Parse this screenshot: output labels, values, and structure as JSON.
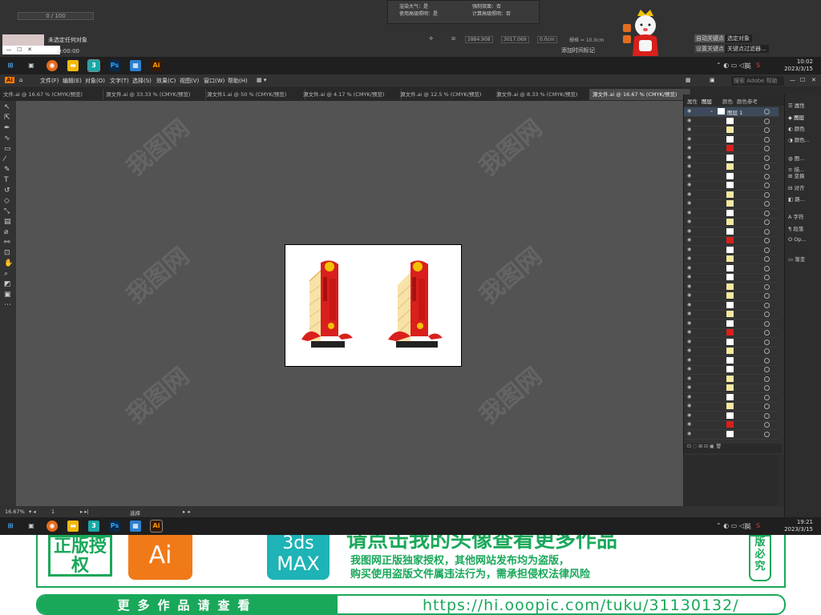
{
  "top_region": {
    "progress_text": "0 / 100",
    "no_selection": "未选定任何对象",
    "timecode": "0:00:00",
    "doc_info": {
      "row1_a": "渲染大气：是",
      "row1_b": "强制双面：否",
      "row2_a": "使用高级照明：是",
      "row2_b": "计算高级照明：否"
    },
    "coord_x": "2884.908",
    "coord_y": "3017.069",
    "coord_z": "0.0cm",
    "grid_label": "栅格 = 10.0cm",
    "add_time_marker": "添加时间标记",
    "auto_key": "自动关键点",
    "select_object": "选定对象",
    "set_key": "设置关键点",
    "key_filter": "关键点过滤器..."
  },
  "taskbar_top": {
    "time": "10:02",
    "date": "2023/3/15",
    "lang": "英"
  },
  "ai_menu": [
    "文件(F)",
    "编辑(E)",
    "对象(O)",
    "文字(T)",
    "选择(S)",
    "效果(C)",
    "视图(V)",
    "窗口(W)",
    "帮助(H)"
  ],
  "search_placeholder": "搜索 Adobe 帮助",
  "doc_tabs": [
    "文件.ai @ 16.67 % (CMYK/预览)",
    "源文件.ai @ 33.33 % (CMYK/预览)",
    "源文件1.ai @ 50 % (CMYK/预览)",
    "源文件.ai @ 4.17 % (CMYK/预览)",
    "源文件.ai @ 12.5 % (CMYK/预览)",
    "源文件.ai @ 8.33 % (CMYK/预览)",
    "源文件.ai @ 16.67 % (CMYK/预览)"
  ],
  "status_bar": {
    "zoom": "16.67%",
    "page": "1",
    "tool": "选择"
  },
  "layers_panel": {
    "tabs": [
      "属性",
      "图层",
      "颜色",
      "颜色参考"
    ],
    "layer_name": "图层 1"
  },
  "right_dock": [
    "属性",
    "图层",
    "颜色",
    "颜色...",
    "图...",
    "描...",
    "变换",
    "对齐",
    "路...",
    "字符",
    "段落",
    "Op...",
    "渐变"
  ],
  "taskbar_bottom": {
    "time": "19:21",
    "date": "2023/3/15",
    "lang": "英"
  },
  "banner": {
    "stamp": "正版授权",
    "ai_logo": "Ai",
    "max_logo_top": "3ds",
    "max_logo_bottom": "MAX",
    "headline": "请点击我的头像查看更多作品",
    "line1": "我图网正版独家授权，其他网站发布均为盗版，",
    "line2": "购买使用盗版文件属违法行为，需承担侵权法律风险",
    "side": "版必究",
    "cta": "更多作品请查看",
    "url": "https://hi.ooopic.com/tuku/31130132/"
  },
  "watermark": "我图网",
  "colors": {
    "accent_green": "#19a85a",
    "ai_orange": "#f07a18",
    "max_teal": "#1eb3b6",
    "sign_red": "#d9201c"
  }
}
